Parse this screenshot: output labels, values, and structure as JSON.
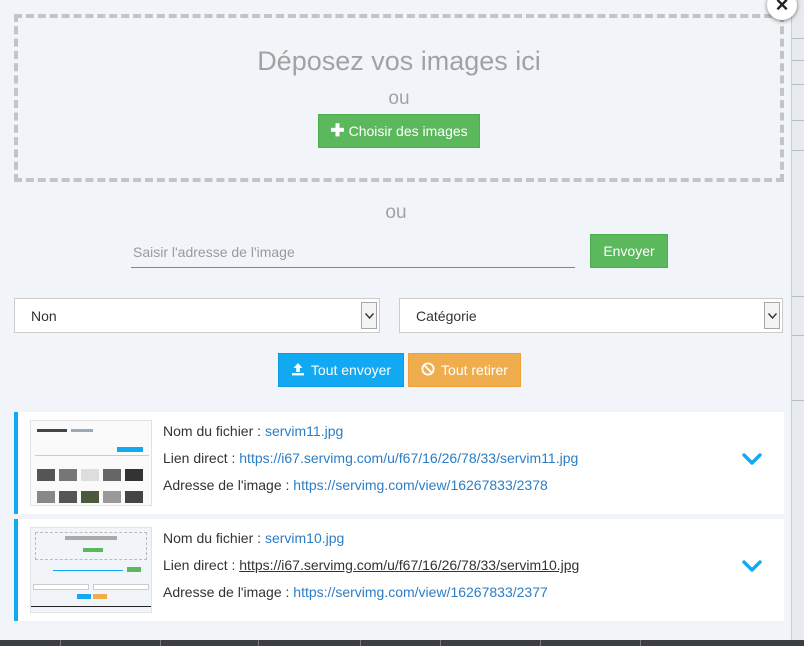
{
  "colors": {
    "accent_blue": "#10a9f2",
    "green": "#5cb85c",
    "orange": "#f0ad4e",
    "link": "#2d7dc4"
  },
  "dropzone": {
    "title": "Déposez vos images ici",
    "or": "ou",
    "choose_label": "Choisir des images"
  },
  "url_section": {
    "or": "ou",
    "placeholder": "Saisir l'adresse de l'image",
    "value": "",
    "send_label": "Envoyer"
  },
  "selects": {
    "left_value": "Non",
    "right_value": "Catégorie"
  },
  "actions": {
    "send_all_label": "Tout envoyer",
    "remove_all_label": "Tout retirer"
  },
  "files": [
    {
      "name_label": "Nom du fichier : ",
      "name": "servim11.jpg",
      "direct_label": "Lien direct : ",
      "direct": "https://i67.servimg.com/u/f67/16/26/78/33/servim11.jpg",
      "address_label": "Adresse de l'image : ",
      "address": "https://servimg.com/view/16267833/2378"
    },
    {
      "name_label": "Nom du fichier : ",
      "name": "servim10.jpg",
      "direct_label": "Lien direct : ",
      "direct": "https://i67.servimg.com/u/f67/16/26/78/33/servim10.jpg",
      "address_label": "Adresse de l'image : ",
      "address": "https://servimg.com/view/16267833/2377"
    }
  ],
  "icons": {
    "close": "close-icon",
    "plus": "plus-icon",
    "upload": "upload-icon",
    "ban": "ban-icon",
    "chevron": "chevron-down-icon"
  }
}
